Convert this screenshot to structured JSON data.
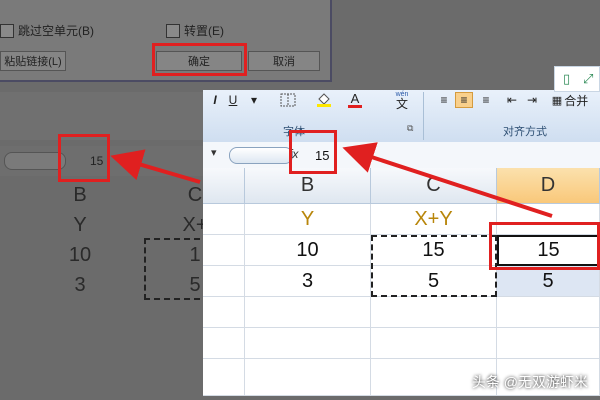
{
  "dialog": {
    "skip_blanks": "跳过空单元(B)",
    "transpose": "转置(E)",
    "paste_link": "粘贴链接(L)",
    "ok": "确定",
    "cancel": "取消"
  },
  "bg_formula": {
    "value": "15"
  },
  "bg_grid": {
    "col_b": "B",
    "col_c": "C",
    "r1b": "Y",
    "r1c": "X+",
    "r2b": "10",
    "r2c": "1",
    "r3b": "3",
    "r3c": "5"
  },
  "ribbon": {
    "italic": "I",
    "underline": "U",
    "font_color": "A",
    "wen": "wén",
    "wen_char": "文",
    "merge": "合并",
    "font_group": "字体",
    "align_group": "对齐方式"
  },
  "formula_bar": {
    "fx": "fx",
    "value": "15"
  },
  "sheet": {
    "columns": [
      "B",
      "C",
      "D"
    ],
    "rows": [
      [
        "Y",
        "X+Y",
        ""
      ],
      [
        "10",
        "15",
        "15"
      ],
      [
        "3",
        "5",
        "5"
      ]
    ]
  },
  "watermark": "头条 @无双游虾米",
  "colors": {
    "highlight": "#e02020",
    "header_active": "#f9d08c"
  }
}
